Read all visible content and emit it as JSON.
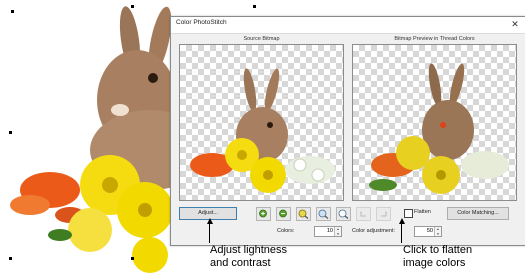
{
  "dialog": {
    "title": "Color PhotoStitch",
    "close_glyph": "✕",
    "source_label": "Source Bitmap",
    "preview_label": "Bitmap Preview in Thread Colors",
    "adjust_label": "Adjust...",
    "zoom_icons": [
      "zoom-in-icon",
      "zoom-out-icon",
      "zoom-box-icon",
      "zoom-fit-icon",
      "zoom-actual-icon",
      "undo-icon",
      "redo-icon"
    ],
    "flatten_label": "Flatten",
    "flatten_checked": false,
    "color_matching_label": "Color Matching...",
    "colors_label": "Colors:",
    "colors_value": "10",
    "color_adjustment_label": "Color adjustment:",
    "color_adjustment_value": "50"
  },
  "callouts": {
    "adjust_line1": "Adjust lightness",
    "adjust_line2": "and contrast",
    "flatten_line1": "Click to flatten",
    "flatten_line2": "image colors"
  },
  "colors": {
    "accent_border": "#3c7fb1",
    "flower_yellow": "#f2d900",
    "flower_orange": "#ee5a1c",
    "rabbit_brown": "#a0785a"
  }
}
